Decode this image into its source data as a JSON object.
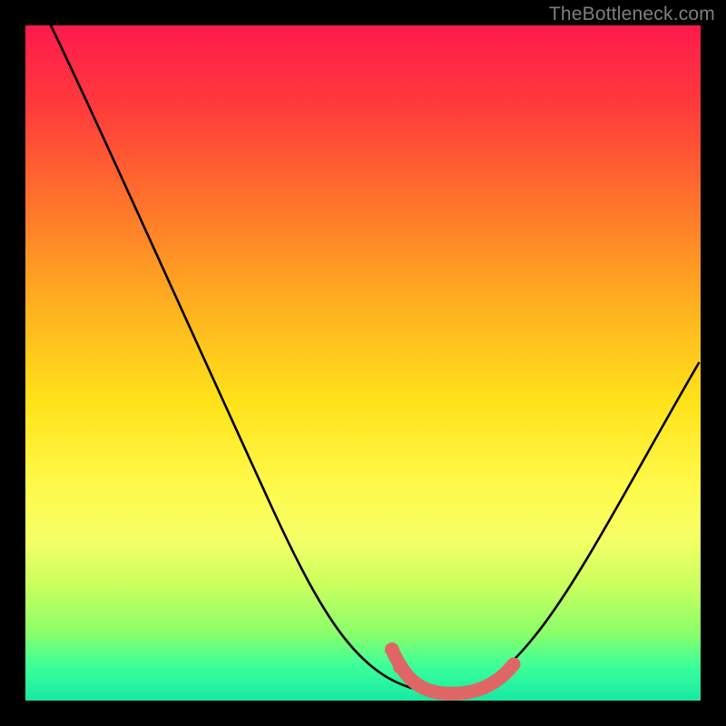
{
  "watermark": "TheBottleneck.com",
  "colors": {
    "black": "#000000",
    "curve_stroke": "#000000",
    "overlay_pink": "#e06666"
  },
  "chart_data": {
    "type": "line",
    "title": "",
    "xlabel": "",
    "ylabel": "",
    "xlim": [
      0,
      100
    ],
    "ylim": [
      0,
      100
    ],
    "annotations": [
      "TheBottleneck.com"
    ],
    "series": [
      {
        "name": "bottleneck-curve",
        "x": [
          4,
          10,
          20,
          30,
          40,
          50,
          55,
          58,
          60,
          62,
          65,
          68,
          70,
          75,
          80,
          85,
          90,
          96
        ],
        "y": [
          100,
          88,
          69,
          50,
          31,
          12,
          5,
          2,
          1,
          1,
          1,
          2,
          3,
          8,
          16,
          26,
          37,
          50
        ]
      },
      {
        "name": "highlight-band",
        "x": [
          55,
          58,
          60,
          62,
          65,
          68,
          70
        ],
        "y": [
          5,
          2,
          1,
          1,
          1,
          2,
          3
        ]
      }
    ]
  }
}
